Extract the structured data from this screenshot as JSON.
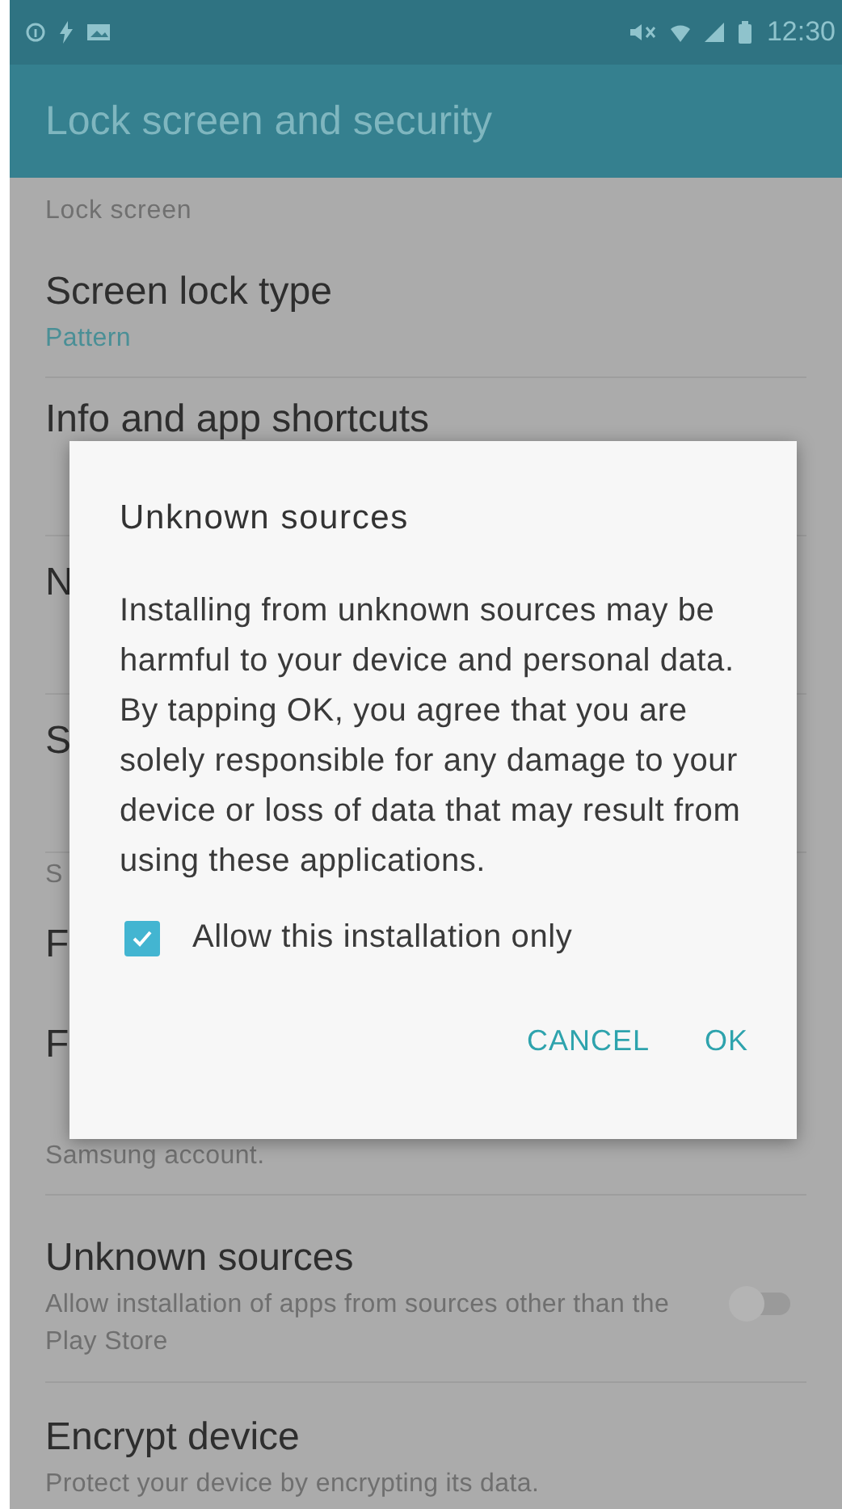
{
  "status_bar": {
    "time": "12:30"
  },
  "app_bar": {
    "title": "Lock screen and security"
  },
  "settings": [
    {
      "kind": "section",
      "title": "Lock screen"
    },
    {
      "kind": "value",
      "title": "Screen lock type",
      "summary": "Pattern"
    },
    {
      "kind": "covered",
      "title": "Info and app shortcuts"
    },
    {
      "kind": "covered",
      "title": "N"
    },
    {
      "kind": "covered",
      "title": "S"
    },
    {
      "kind": "section",
      "title": "S"
    },
    {
      "kind": "short",
      "title": "F"
    },
    {
      "kind": "covered",
      "title": "F",
      "summary": "Samsung account."
    },
    {
      "kind": "toggle",
      "title": "Unknown sources",
      "summary": "Allow installation of apps from sources other than the Play Store",
      "on": false
    },
    {
      "kind": "item",
      "title": "Encrypt device",
      "summary": "Protect your device by encrypting its data."
    }
  ],
  "dialog": {
    "title": "Unknown sources",
    "message": "Installing from unknown sources may be harmful to your device and personal data. By tapping OK, you agree that you are solely responsible for any damage to your device or loss of data that may result from using these applications.",
    "checkbox": {
      "label": "Allow this installation only",
      "checked": true
    },
    "buttons": [
      "CANCEL",
      "OK"
    ]
  }
}
